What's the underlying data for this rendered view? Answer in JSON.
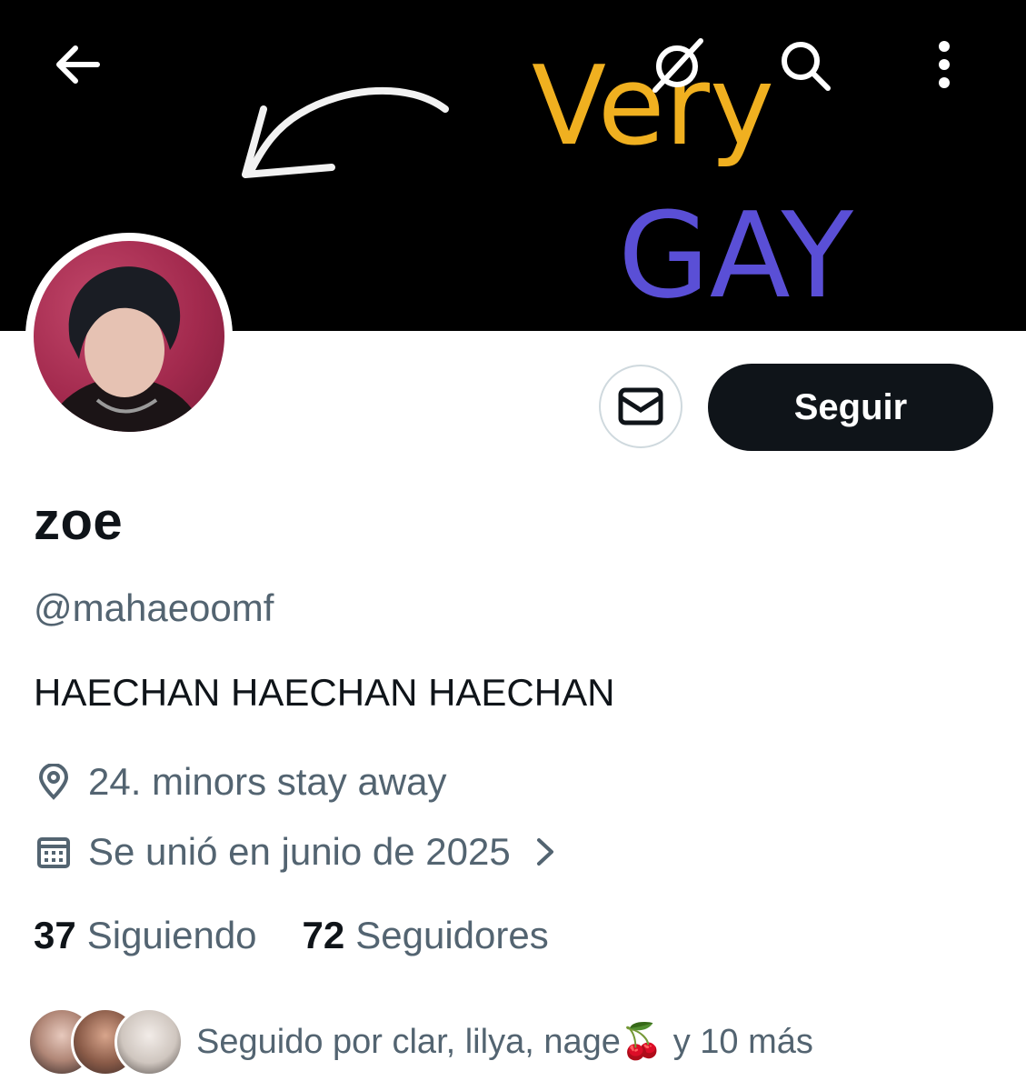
{
  "header": {
    "back_icon": "arrow-left-icon",
    "hide_icon": "eye-slash-icon",
    "search_icon": "search-icon",
    "more_icon": "more-vertical-icon",
    "banner_text_line1": "Very",
    "banner_text_line2": "GAY"
  },
  "actions": {
    "message_icon": "envelope-icon",
    "follow_label": "Seguir"
  },
  "profile": {
    "display_name": "zoe",
    "handle": "@mahaeoomf",
    "bio": "HAECHAN HAECHAN HAECHAN",
    "location": "24. minors stay away",
    "joined": "Se unió en junio de 2025"
  },
  "stats": {
    "following_count": "37",
    "following_label": "Siguiendo",
    "followers_count": "72",
    "followers_label": "Seguidores"
  },
  "followed_by": {
    "text": "Seguido por clar, lilya, nage🍒 y 10 más"
  },
  "colors": {
    "follow_button_bg": "#0f1419",
    "secondary_text": "#536471",
    "banner_bg": "#000000"
  }
}
